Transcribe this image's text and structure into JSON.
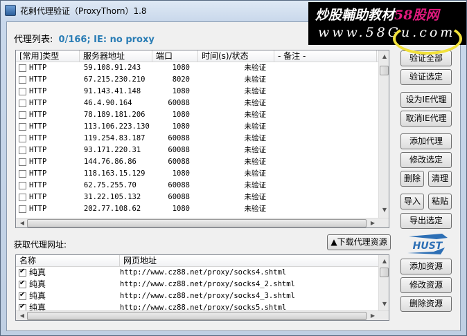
{
  "window": {
    "title": "花剌代理验证（ProxyThorn）1.8"
  },
  "status": {
    "label": "代理列表:",
    "info": "0/166;    IE: no proxy"
  },
  "proxy_table": {
    "columns": [
      "[常用]类型",
      "服务器地址",
      "端口",
      "时间(s)/状态",
      "- 备注 -"
    ],
    "rows": [
      {
        "type": "HTTP",
        "host": "59.108.91.243",
        "port": "1080",
        "status": "未验证"
      },
      {
        "type": "HTTP",
        "host": "67.215.230.210",
        "port": "8020",
        "status": "未验证"
      },
      {
        "type": "HTTP",
        "host": "91.143.41.148",
        "port": "1080",
        "status": "未验证"
      },
      {
        "type": "HTTP",
        "host": "46.4.90.164",
        "port": "60088",
        "status": "未验证"
      },
      {
        "type": "HTTP",
        "host": "78.189.181.206",
        "port": "1080",
        "status": "未验证"
      },
      {
        "type": "HTTP",
        "host": "113.106.223.130",
        "port": "1080",
        "status": "未验证"
      },
      {
        "type": "HTTP",
        "host": "119.254.83.187",
        "port": "60088",
        "status": "未验证"
      },
      {
        "type": "HTTP",
        "host": "93.171.220.31",
        "port": "60088",
        "status": "未验证"
      },
      {
        "type": "HTTP",
        "host": "144.76.86.86",
        "port": "60088",
        "status": "未验证"
      },
      {
        "type": "HTTP",
        "host": "118.163.15.129",
        "port": "1080",
        "status": "未验证"
      },
      {
        "type": "HTTP",
        "host": "62.75.255.70",
        "port": "60088",
        "status": "未验证"
      },
      {
        "type": "HTTP",
        "host": "31.22.105.132",
        "port": "60088",
        "status": "未验证"
      },
      {
        "type": "HTTP",
        "host": "202.77.108.62",
        "port": "1080",
        "status": "未验证"
      }
    ]
  },
  "buttons": {
    "verify_all": "验证全部",
    "verify_selected": "验证选定",
    "set_ie_proxy": "设为IE代理",
    "cancel_ie_proxy": "取消IE代理",
    "add_proxy": "添加代理",
    "edit_selected": "修改选定",
    "delete": "删除",
    "clear": "清理",
    "import": "导入",
    "paste": "粘贴",
    "export_selected": "导出选定",
    "download_sources": "▲下载代理资源",
    "add_source": "添加资源",
    "edit_source": "修改资源",
    "delete_source": "删除资源"
  },
  "source_section": {
    "label": "获取代理网址:",
    "columns": [
      "名称",
      "网页地址"
    ],
    "rows": [
      {
        "checked": true,
        "name": "纯真",
        "url": "http://www.cz88.net/proxy/socks4.shtml"
      },
      {
        "checked": true,
        "name": "纯真",
        "url": "http://www.cz88.net/proxy/socks4_2.shtml"
      },
      {
        "checked": true,
        "name": "纯真",
        "url": "http://www.cz88.net/proxy/socks4_3.shtml"
      },
      {
        "checked": true,
        "name": "纯真",
        "url": "http://www.cz88.net/proxy/socks5.shtml"
      }
    ]
  },
  "logo": {
    "text": "HUST"
  },
  "watermark": {
    "line1_a": "炒股輔助教材",
    "line1_b": "58股网",
    "line2": "www.58Gu.com"
  }
}
